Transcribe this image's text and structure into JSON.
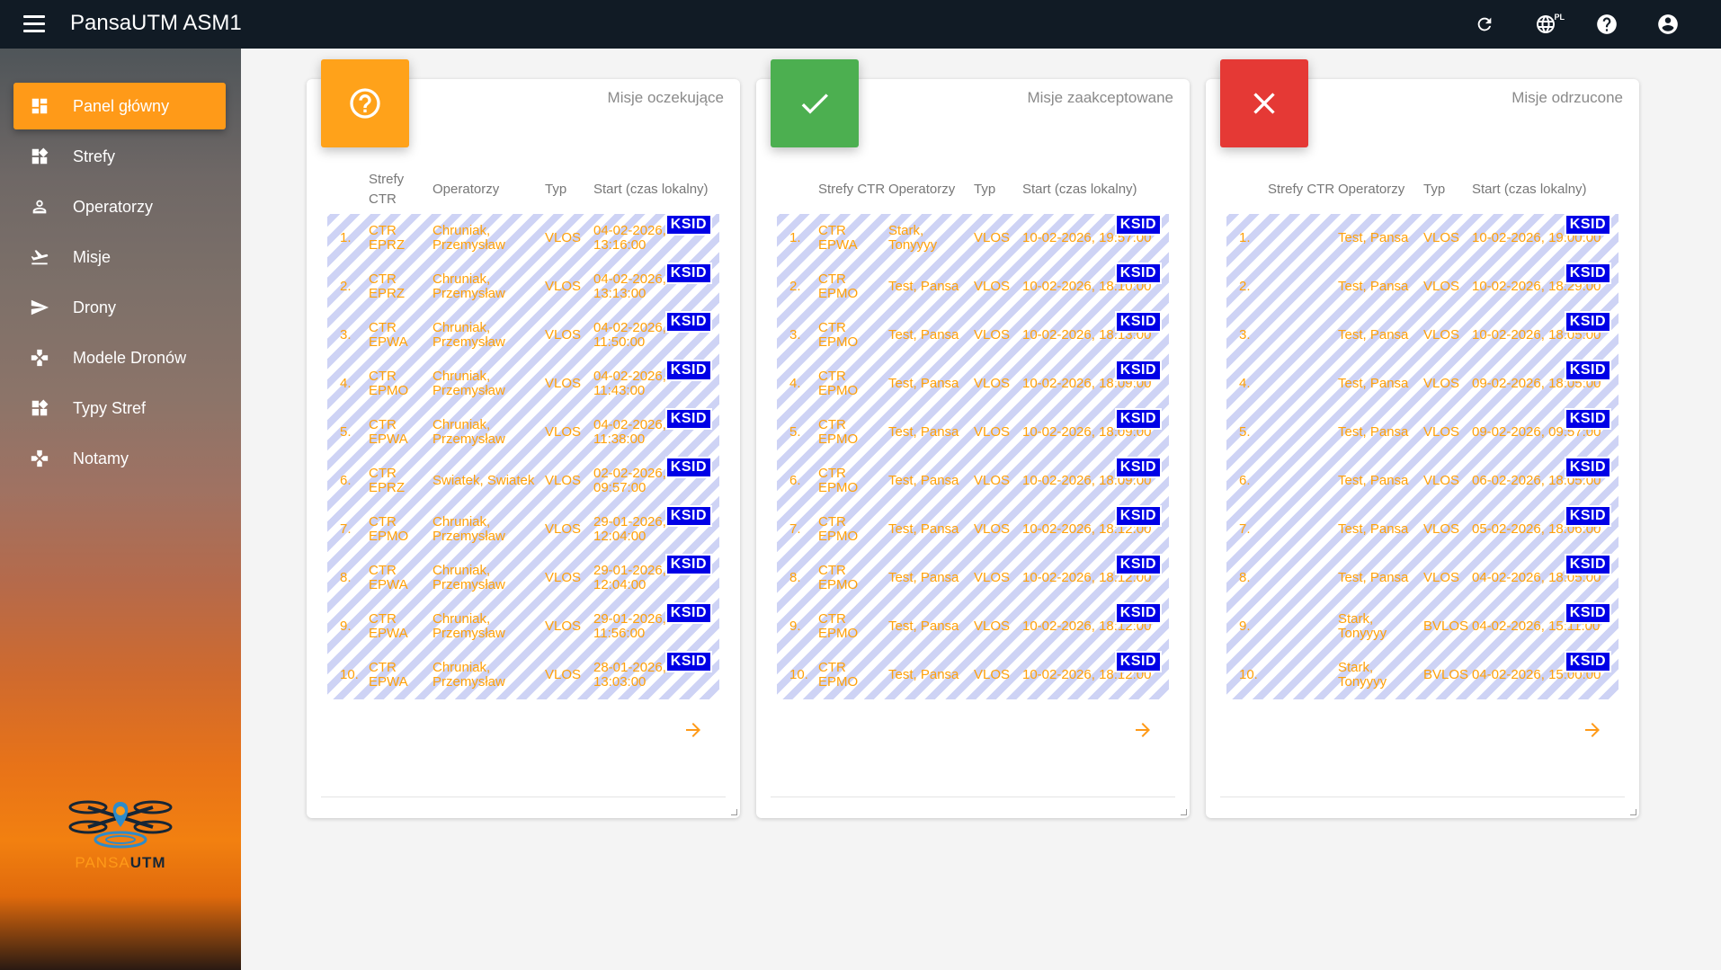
{
  "app": {
    "title": "PansaUTM ASM1",
    "lang": "PL"
  },
  "topbar": {
    "icons": [
      "refresh-icon",
      "globe-icon",
      "help-icon",
      "account-icon"
    ]
  },
  "sidebar": {
    "items": [
      {
        "label": "Panel główny",
        "icon": "dashboard-icon",
        "active": true
      },
      {
        "label": "Strefy",
        "icon": "zones-icon"
      },
      {
        "label": "Operatorzy",
        "icon": "person-icon"
      },
      {
        "label": "Misje",
        "icon": "flight-takeoff-icon"
      },
      {
        "label": "Drony",
        "icon": "send-icon"
      },
      {
        "label": "Modele Dronów",
        "icon": "gamepad-icon"
      },
      {
        "label": "Typy Stref",
        "icon": "zones-icon"
      },
      {
        "label": "Notamy",
        "icon": "gamepad-icon"
      }
    ],
    "logo": {
      "part1": "PANSA",
      "part2": "UTM"
    }
  },
  "colors": {
    "accent": "#ff9a18",
    "pending": "#ffa21a",
    "accepted": "#4caf50",
    "rejected": "#e53935",
    "ksid": "#0000e6"
  },
  "headers": {
    "strefy": "Strefy CTR",
    "operatorzy": "Operatorzy",
    "typ": "Typ",
    "start": "Start (czas lokalny)"
  },
  "ksid_label": "KSID",
  "cards": [
    {
      "title": "Misje oczekujące",
      "rows": [
        {
          "n": "1.",
          "s": "CTR EPRZ",
          "o": "Chruniak, Przemysław",
          "t": "VLOS",
          "d": "04-02-2026, 13:16:00"
        },
        {
          "n": "2.",
          "s": "CTR EPRZ",
          "o": "Chruniak, Przemysław",
          "t": "VLOS",
          "d": "04-02-2026, 13:13:00"
        },
        {
          "n": "3.",
          "s": "CTR EPWA",
          "o": "Chruniak, Przemysław",
          "t": "VLOS",
          "d": "04-02-2026, 11:50:00"
        },
        {
          "n": "4.",
          "s": "CTR EPMO",
          "o": "Chruniak, Przemysław",
          "t": "VLOS",
          "d": "04-02-2026, 11:43:00"
        },
        {
          "n": "5.",
          "s": "CTR EPWA",
          "o": "Chruniak, Przemysław",
          "t": "VLOS",
          "d": "04-02-2026, 11:38:00"
        },
        {
          "n": "6.",
          "s": "CTR EPRZ",
          "o": "Swiatek, Swiatek",
          "t": "VLOS",
          "d": "02-02-2026, 09:57:00"
        },
        {
          "n": "7.",
          "s": "CTR EPMO",
          "o": "Chruniak, Przemysław",
          "t": "VLOS",
          "d": "29-01-2026, 12:04:00"
        },
        {
          "n": "8.",
          "s": "CTR EPWA",
          "o": "Chruniak, Przemysław",
          "t": "VLOS",
          "d": "29-01-2026, 12:04:00"
        },
        {
          "n": "9.",
          "s": "CTR EPWA",
          "o": "Chruniak, Przemysław",
          "t": "VLOS",
          "d": "29-01-2026, 11:56:00"
        },
        {
          "n": "10.",
          "s": "CTR EPWA",
          "o": "Chruniak, Przemysław",
          "t": "VLOS",
          "d": "28-01-2026, 13:03:00"
        }
      ]
    },
    {
      "title": "Misje zaakceptowane",
      "rows": [
        {
          "n": "1.",
          "s": "CTR EPWA",
          "o": "Stark, Tonyyyy",
          "t": "VLOS",
          "d": "10-02-2026, 19:57:00"
        },
        {
          "n": "2.",
          "s": "CTR EPMO",
          "o": "Test, Pansa",
          "t": "VLOS",
          "d": "10-02-2026, 18:10:00"
        },
        {
          "n": "3.",
          "s": "CTR EPMO",
          "o": "Test, Pansa",
          "t": "VLOS",
          "d": "10-02-2026, 18:13:00"
        },
        {
          "n": "4.",
          "s": "CTR EPMO",
          "o": "Test, Pansa",
          "t": "VLOS",
          "d": "10-02-2026, 18:09:00"
        },
        {
          "n": "5.",
          "s": "CTR EPMO",
          "o": "Test, Pansa",
          "t": "VLOS",
          "d": "10-02-2026, 18:09:00"
        },
        {
          "n": "6.",
          "s": "CTR EPMO",
          "o": "Test, Pansa",
          "t": "VLOS",
          "d": "10-02-2026, 18:09:00"
        },
        {
          "n": "7.",
          "s": "CTR EPMO",
          "o": "Test, Pansa",
          "t": "VLOS",
          "d": "10-02-2026, 18:12:00"
        },
        {
          "n": "8.",
          "s": "CTR EPMO",
          "o": "Test, Pansa",
          "t": "VLOS",
          "d": "10-02-2026, 18:12:00"
        },
        {
          "n": "9.",
          "s": "CTR EPMO",
          "o": "Test, Pansa",
          "t": "VLOS",
          "d": "10-02-2026, 18:12:00"
        },
        {
          "n": "10.",
          "s": "CTR EPMO",
          "o": "Test, Pansa",
          "t": "VLOS",
          "d": "10-02-2026, 18:12:00"
        }
      ]
    },
    {
      "title": "Misje odrzucone",
      "rows": [
        {
          "n": "1.",
          "s": "",
          "o": "Test, Pansa",
          "t": "VLOS",
          "d": "10-02-2026, 19:00:00"
        },
        {
          "n": "2.",
          "s": "",
          "o": "Test, Pansa",
          "t": "VLOS",
          "d": "10-02-2026, 18:29:00"
        },
        {
          "n": "3.",
          "s": "",
          "o": "Test, Pansa",
          "t": "VLOS",
          "d": "10-02-2026, 18:05:00"
        },
        {
          "n": "4.",
          "s": "",
          "o": "Test, Pansa",
          "t": "VLOS",
          "d": "09-02-2026, 18:05:00"
        },
        {
          "n": "5.",
          "s": "",
          "o": "Test, Pansa",
          "t": "VLOS",
          "d": "09-02-2026, 09:57:00"
        },
        {
          "n": "6.",
          "s": "",
          "o": "Test, Pansa",
          "t": "VLOS",
          "d": "06-02-2026, 18:05:00"
        },
        {
          "n": "7.",
          "s": "",
          "o": "Test, Pansa",
          "t": "VLOS",
          "d": "05-02-2026, 18:06:00"
        },
        {
          "n": "8.",
          "s": "",
          "o": "Test, Pansa",
          "t": "VLOS",
          "d": "04-02-2026, 18:05:00"
        },
        {
          "n": "9.",
          "s": "",
          "o": "Stark, Tonyyyy",
          "t": "BVLOS",
          "d": "04-02-2026, 15:11:00"
        },
        {
          "n": "10.",
          "s": "",
          "o": "Stark, Tonyyyy",
          "t": "BVLOS",
          "d": "04-02-2026, 15:00:00"
        }
      ]
    }
  ]
}
